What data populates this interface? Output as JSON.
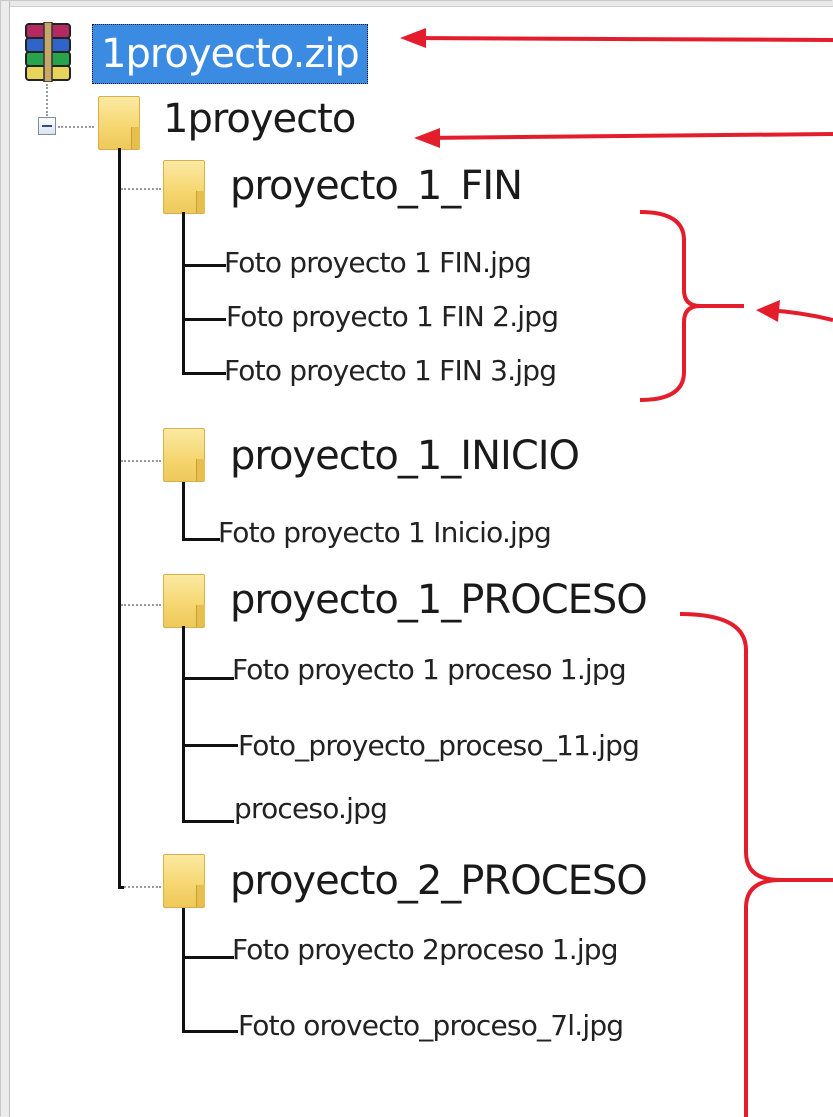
{
  "tree": {
    "archive": {
      "label": "1proyecto.zip",
      "icon": "winrar-archive-icon"
    },
    "root": {
      "label": "1proyecto",
      "icon": "folder-icon",
      "expander": "minus"
    },
    "folders": [
      {
        "label": "proyecto_1_FIN",
        "files": [
          "Foto proyecto 1 FIN.jpg",
          "Foto proyecto 1 FIN 2.jpg",
          "Foto proyecto 1 FIN 3.jpg"
        ]
      },
      {
        "label": "proyecto_1_INICIO",
        "files": [
          "Foto proyecto 1 Inicio.jpg"
        ]
      },
      {
        "label": "proyecto_1_PROCESO",
        "files": [
          "Foto proyecto 1 proceso 1.jpg",
          "Foto_proyecto_proceso_11.jpg",
          "proceso.jpg"
        ]
      },
      {
        "label": "proyecto_2_PROCESO",
        "files": [
          "Foto proyecto 2proceso 1.jpg",
          "Foto  orovecto_proceso_7l.jpg"
        ]
      }
    ]
  },
  "colors": {
    "selection": "#3b8be3",
    "annotation": "#e41d2d",
    "folder": "#f6d772"
  }
}
